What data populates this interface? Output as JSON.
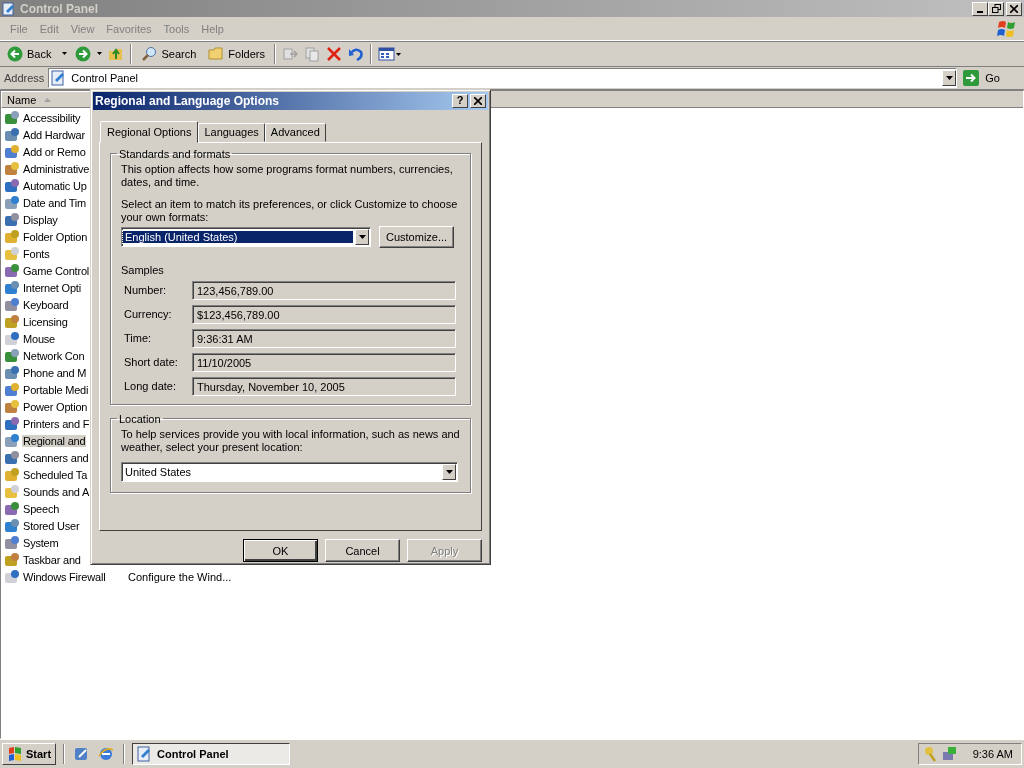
{
  "window": {
    "title": "Control Panel"
  },
  "menu": [
    "File",
    "Edit",
    "View",
    "Favorites",
    "Tools",
    "Help"
  ],
  "toolbar": {
    "back": "Back",
    "search": "Search",
    "folders": "Folders"
  },
  "address": {
    "label": "Address",
    "value": "Control Panel",
    "go": "Go"
  },
  "list": {
    "column": "Name",
    "items": [
      {
        "name": "Accessibility",
        "selected": false
      },
      {
        "name": "Add Hardwar",
        "selected": false
      },
      {
        "name": "Add or Remo",
        "selected": false
      },
      {
        "name": "Administrative",
        "selected": false
      },
      {
        "name": "Automatic Up",
        "selected": false
      },
      {
        "name": "Date and Tim",
        "selected": false
      },
      {
        "name": "Display",
        "selected": false
      },
      {
        "name": "Folder Option",
        "selected": false
      },
      {
        "name": "Fonts",
        "selected": false
      },
      {
        "name": "Game Control",
        "selected": false
      },
      {
        "name": "Internet Opti",
        "selected": false
      },
      {
        "name": "Keyboard",
        "selected": false
      },
      {
        "name": "Licensing",
        "selected": false
      },
      {
        "name": "Mouse",
        "selected": false
      },
      {
        "name": "Network Con",
        "selected": false
      },
      {
        "name": "Phone and M",
        "selected": false
      },
      {
        "name": "Portable Medi",
        "selected": false
      },
      {
        "name": "Power Option",
        "selected": false
      },
      {
        "name": "Printers and F",
        "selected": false
      },
      {
        "name": "Regional and",
        "selected": true
      },
      {
        "name": "Scanners and",
        "selected": false
      },
      {
        "name": "Scheduled Ta",
        "selected": false
      },
      {
        "name": "Sounds and A",
        "selected": false
      },
      {
        "name": "Speech",
        "selected": false
      },
      {
        "name": "Stored User",
        "selected": false
      },
      {
        "name": "System",
        "selected": false
      },
      {
        "name": "Taskbar and",
        "selected": false
      },
      {
        "name": "Windows Firewall",
        "selected": false,
        "comment": "Configure the Wind..."
      }
    ]
  },
  "dialog": {
    "title": "Regional and Language Options",
    "help": "?",
    "tabs": [
      {
        "label": "Regional Options",
        "selected": true
      },
      {
        "label": "Languages",
        "selected": false
      },
      {
        "label": "Advanced",
        "selected": false
      }
    ],
    "standards": {
      "legend": "Standards and formats",
      "description": "This option affects how some programs format numbers, currencies, dates, and time.",
      "prompt": "Select an item to match its preferences, or click Customize to choose your own formats:",
      "format": "English (United States)",
      "customize": "Customize...",
      "samples_label": "Samples",
      "samples": [
        {
          "label": "Number:",
          "value": "123,456,789.00"
        },
        {
          "label": "Currency:",
          "value": "$123,456,789.00"
        },
        {
          "label": "Time:",
          "value": "9:36:31 AM"
        },
        {
          "label": "Short date:",
          "value": "11/10/2005"
        },
        {
          "label": "Long date:",
          "value": "Thursday, November 10, 2005"
        }
      ]
    },
    "location": {
      "legend": "Location",
      "description": "To help services provide you with local information, such as news and weather, select your present location:",
      "value": "United States"
    },
    "buttons": [
      {
        "label": "OK",
        "kind": "default",
        "disabled": false
      },
      {
        "label": "Cancel",
        "kind": "normal",
        "disabled": false
      },
      {
        "label": "Apply",
        "kind": "normal",
        "disabled": true
      }
    ]
  },
  "taskbar": {
    "start": "Start",
    "tasks": [
      {
        "label": "Control Panel",
        "selected": true
      }
    ],
    "clock": "9:36 AM"
  }
}
